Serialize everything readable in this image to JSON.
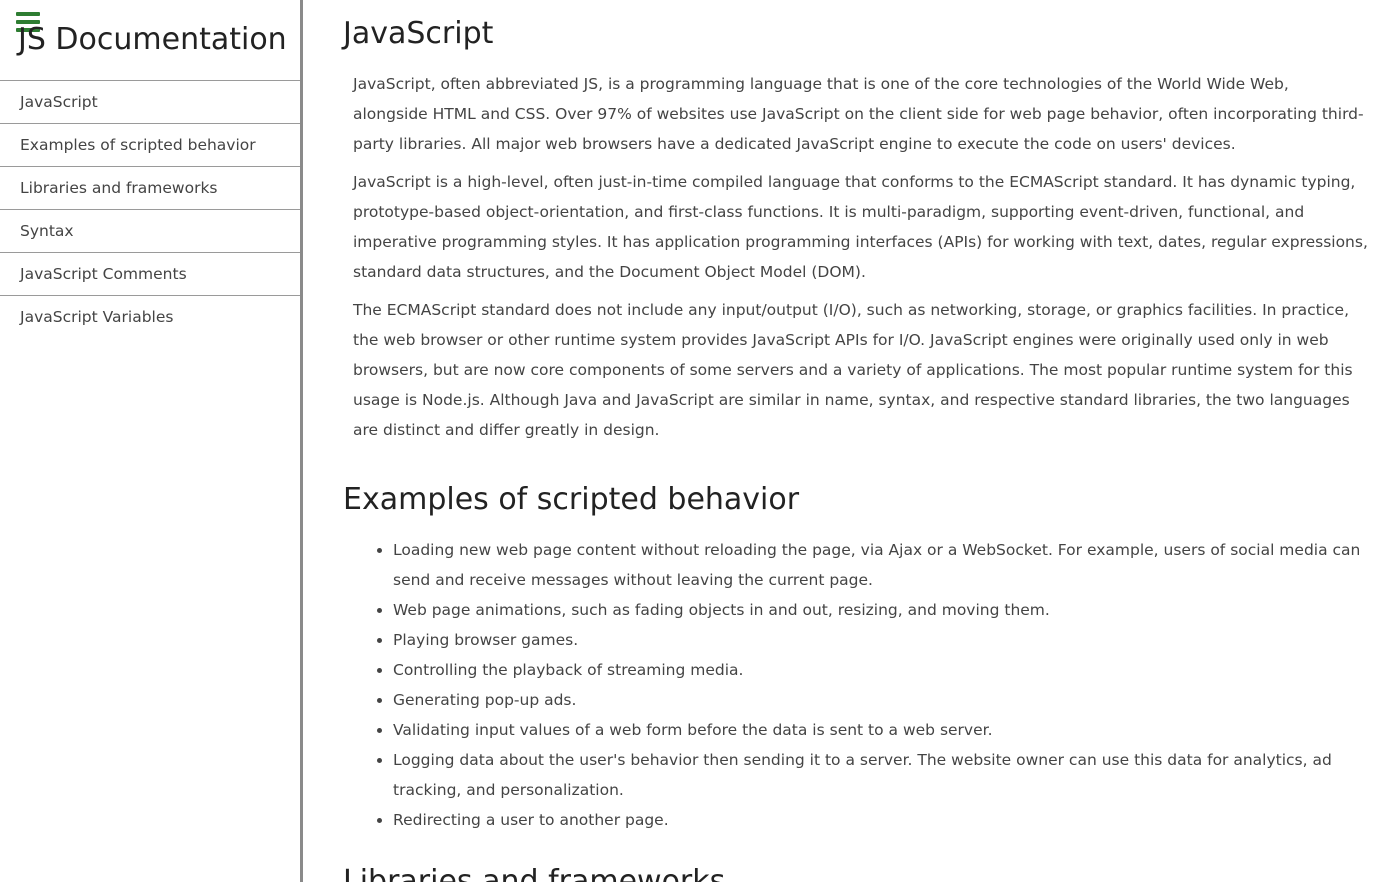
{
  "nav": {
    "title": "JS Documentation",
    "items": [
      {
        "label": "JavaScript"
      },
      {
        "label": "Examples of scripted behavior"
      },
      {
        "label": "Libraries and frameworks"
      },
      {
        "label": "Syntax"
      },
      {
        "label": "JavaScript Comments"
      },
      {
        "label": "JavaScript Variables"
      }
    ]
  },
  "main": {
    "sections": [
      {
        "heading": "JavaScript",
        "paragraphs": [
          "JavaScript, often abbreviated JS, is a programming language that is one of the core technologies of the World Wide Web, alongside HTML and CSS. Over 97% of websites use JavaScript on the client side for web page behavior, often incorporating third-party libraries. All major web browsers have a dedicated JavaScript engine to execute the code on users' devices.",
          "JavaScript is a high-level, often just-in-time compiled language that conforms to the ECMAScript standard. It has dynamic typing, prototype-based object-orientation, and first-class functions. It is multi-paradigm, supporting event-driven, functional, and imperative programming styles. It has application programming interfaces (APIs) for working with text, dates, regular expressions, standard data structures, and the Document Object Model (DOM).",
          "The ECMAScript standard does not include any input/output (I/O), such as networking, storage, or graphics facilities. In practice, the web browser or other runtime system provides JavaScript APIs for I/O. JavaScript engines were originally used only in web browsers, but are now core components of some servers and a variety of applications. The most popular runtime system for this usage is Node.js. Although Java and JavaScript are similar in name, syntax, and respective standard libraries, the two languages are distinct and differ greatly in design."
        ]
      },
      {
        "heading": "Examples of scripted behavior",
        "bullets": [
          "Loading new web page content without reloading the page, via Ajax or a WebSocket. For example, users of social media can send and receive messages without leaving the current page.",
          "Web page animations, such as fading objects in and out, resizing, and moving them.",
          "Playing browser games.",
          "Controlling the playback of streaming media.",
          "Generating pop-up ads.",
          "Validating input values of a web form before the data is sent to a web server.",
          "Logging data about the user's behavior then sending it to a server. The website owner can use this data for analytics, ad tracking, and personalization.",
          "Redirecting a user to another page."
        ]
      },
      {
        "heading": "Libraries and frameworks"
      }
    ]
  },
  "colors": {
    "accent": "#2e7d32",
    "border": "#8a8a8a",
    "text": "#444444",
    "heading": "#222222"
  },
  "icons": {
    "menu": "hamburger-menu-icon"
  }
}
